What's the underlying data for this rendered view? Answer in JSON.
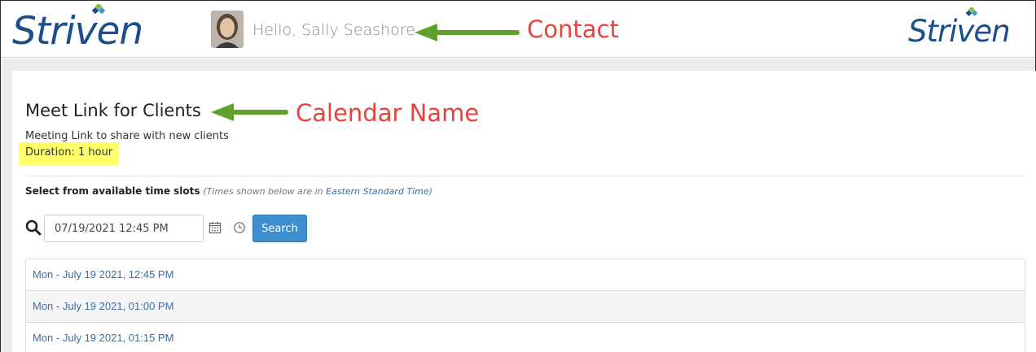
{
  "header": {
    "logo_left": "Striven",
    "logo_right": "Striven",
    "greeting": "Hello, Sally Seashore",
    "avatar": "user-avatar"
  },
  "annotations": {
    "contact": "Contact",
    "calendar_name": "Calendar Name",
    "arrow_color": "#5ea12b",
    "label_color": "#e8423c"
  },
  "meeting": {
    "title": "Meet Link for Clients",
    "description": "Meeting Link to share with new clients",
    "duration": "Duration: 1 hour"
  },
  "slots": {
    "heading": "Select from available time slots",
    "note_prefix": "(Times shown below are in",
    "timezone": "Eastern Standard Time",
    "note_suffix": ")",
    "search_value": "07/19/2021 12:45 PM",
    "search_button": "Search",
    "items": [
      "Mon - July 19 2021, 12:45 PM",
      "Mon - July 19 2021, 01:00 PM",
      "Mon - July 19 2021, 01:15 PM"
    ]
  },
  "colors": {
    "brand_blue": "#1c4e8c",
    "button_blue": "#3f8ed0",
    "link_blue": "#3a6ea5",
    "highlight": "#ffff66"
  },
  "icons": [
    "search-icon",
    "calendar-icon",
    "clock-icon",
    "logo-diamond-icon"
  ]
}
